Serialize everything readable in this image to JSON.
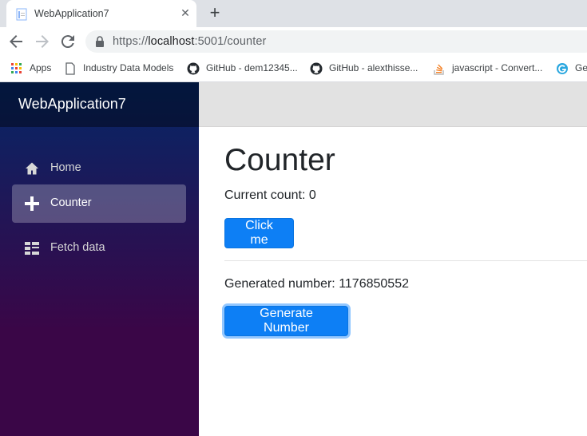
{
  "browser": {
    "tab_title": "WebApplication7",
    "tab_close": "✕",
    "new_tab": "+",
    "url_prefix": "https://",
    "url_host": "localhost",
    "url_rest": ":5001/counter",
    "bookmarks": [
      {
        "label": "Apps",
        "icon": "apps-grid-icon"
      },
      {
        "label": "Industry Data Models",
        "icon": "page-icon"
      },
      {
        "label": "GitHub - dem12345...",
        "icon": "github-icon"
      },
      {
        "label": "GitHub - alexthisse...",
        "icon": "github-icon"
      },
      {
        "label": "javascript - Convert...",
        "icon": "stackoverflow-icon"
      },
      {
        "label": "Ge",
        "icon": "site-icon"
      }
    ]
  },
  "app": {
    "brand": "WebApplication7",
    "nav": [
      {
        "label": "Home",
        "icon": "home-icon",
        "active": false
      },
      {
        "label": "Counter",
        "icon": "plus-icon",
        "active": true
      },
      {
        "label": "Fetch data",
        "icon": "list-icon",
        "active": false
      }
    ],
    "page_title": "Counter",
    "count_text": "Current count: 0",
    "click_button": "Click me",
    "generated_text": "Generated number: 1176850552",
    "generate_button": "Generate Number"
  },
  "colors": {
    "sidebar_top": "#052767",
    "sidebar_bottom": "#3a0647",
    "button": "#0d7ff5"
  }
}
